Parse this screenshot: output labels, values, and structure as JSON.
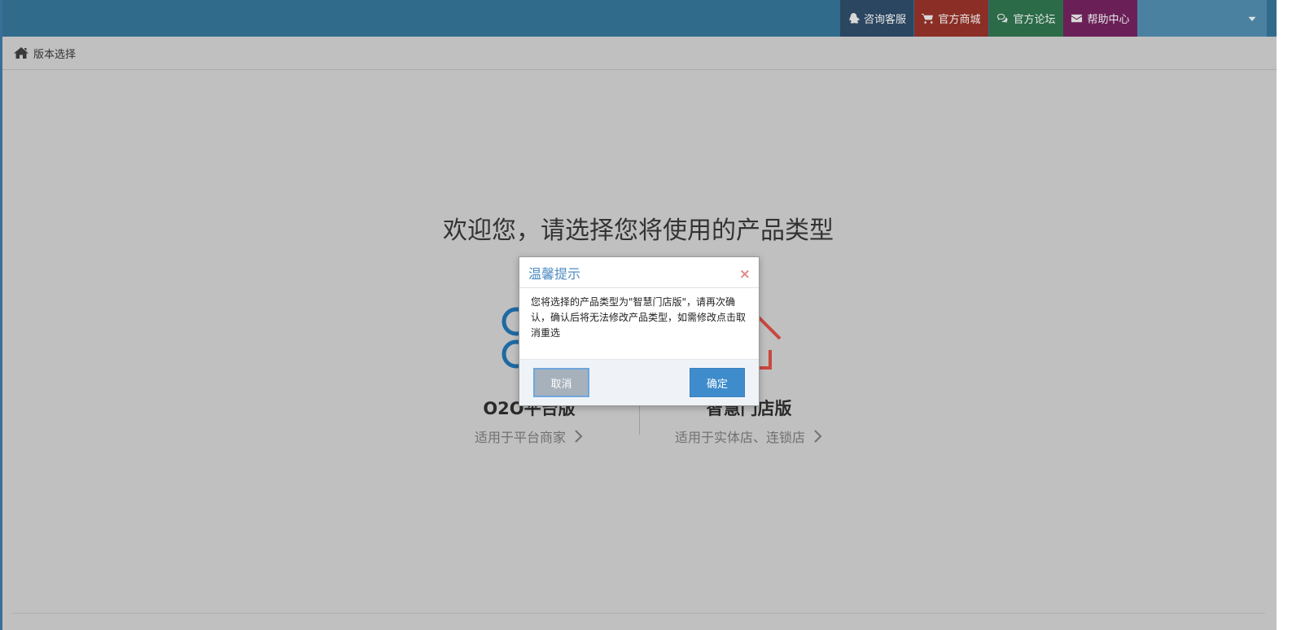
{
  "topbar": {
    "consult_label": "咨询客服",
    "shop_label": "官方商城",
    "forum_label": "官方论坛",
    "help_label": "帮助中心"
  },
  "breadcrumb": {
    "label": "版本选择"
  },
  "welcome": {
    "title": "欢迎您，请选择您将使用的产品类型"
  },
  "products": [
    {
      "title": "O2O平台版",
      "subtitle": "适用于平台商家",
      "icon": "o2o-circles-icon",
      "color": "#1e6aa3"
    },
    {
      "title": "智慧门店版",
      "subtitle": "适用于实体店、连锁店",
      "icon": "store-house-icon",
      "color": "#c9473f"
    }
  ],
  "dialog": {
    "title": "温馨提示",
    "close": "×",
    "message": "您将选择的产品类型为\"智慧门店版\"，请再次确认，确认后将无法修改产品类型，如需修改点击取消重选",
    "cancel_label": "取消",
    "ok_label": "确定"
  },
  "colors": {
    "topbar": "#306b8c",
    "consult": "#2b4661",
    "shop": "#8b2f26",
    "forum": "#2b6b48",
    "help": "#6a2057",
    "accent": "#3f8ccd"
  }
}
